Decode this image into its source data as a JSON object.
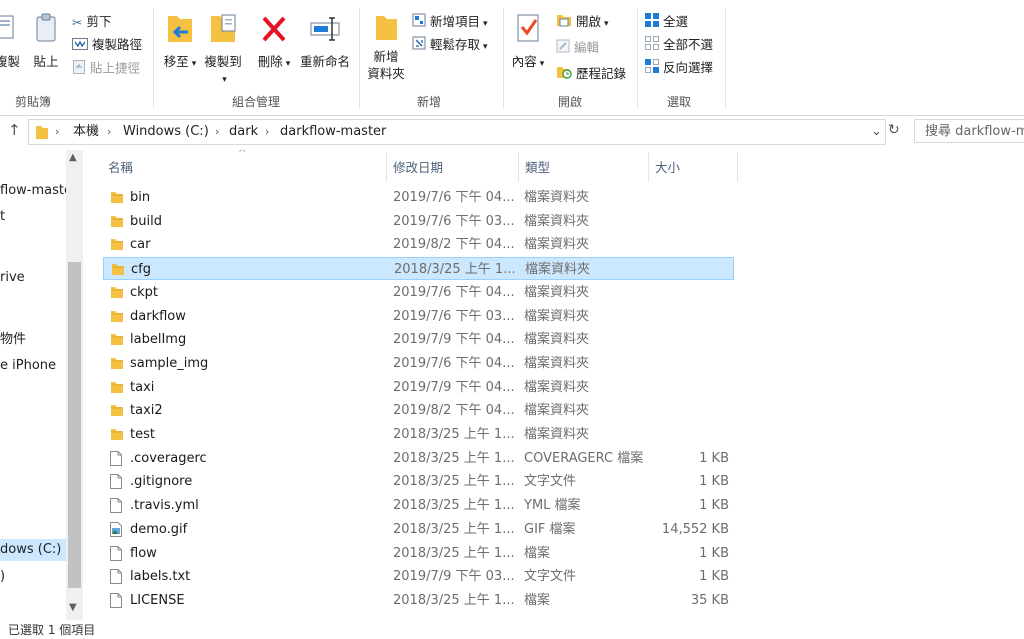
{
  "ribbon": {
    "clipboard": {
      "group_label": "剪貼簿",
      "copy_label": "複製",
      "paste_label": "貼上",
      "cut_label": "剪下",
      "copy_path_label": "複製路徑",
      "paste_shortcut_label": "貼上捷徑"
    },
    "organize": {
      "group_label": "組合管理",
      "move_to_label": "移至",
      "copy_to_label": "複製到",
      "delete_label": "刪除",
      "rename_label": "重新命名"
    },
    "new": {
      "group_label": "新增",
      "new_folder_label_line1": "新增",
      "new_folder_label_line2": "資料夾",
      "new_item_label": "新增項目",
      "easy_access_label": "輕鬆存取"
    },
    "open": {
      "group_label": "開啟",
      "properties_label": "內容",
      "open_label": "開啟",
      "edit_label": "編輯",
      "history_label": "歷程記錄"
    },
    "select": {
      "group_label": "選取",
      "select_all_label": "全選",
      "select_none_label": "全部不選",
      "invert_label": "反向選擇"
    }
  },
  "address": {
    "crumbs": [
      "本機",
      "Windows (C:)",
      "dark",
      "darkflow-master"
    ],
    "search_placeholder": "搜尋 darkflow-m"
  },
  "nav": {
    "items": [
      "flow-maste",
      "t",
      "rive",
      "物件",
      "e iPhone",
      "dows (C:)",
      ")"
    ]
  },
  "columns": {
    "name": "名稱",
    "date": "修改日期",
    "type": "類型",
    "size": "大小"
  },
  "files": [
    {
      "name": "bin",
      "date": "2019/7/6 下午 04...",
      "type": "檔案資料夾",
      "size": "",
      "icon": "folder"
    },
    {
      "name": "build",
      "date": "2019/7/6 下午 03...",
      "type": "檔案資料夾",
      "size": "",
      "icon": "folder"
    },
    {
      "name": "car",
      "date": "2019/8/2 下午 04...",
      "type": "檔案資料夾",
      "size": "",
      "icon": "folder"
    },
    {
      "name": "cfg",
      "date": "2018/3/25 上午 1...",
      "type": "檔案資料夾",
      "size": "",
      "icon": "folder"
    },
    {
      "name": "ckpt",
      "date": "2019/7/6 下午 04...",
      "type": "檔案資料夾",
      "size": "",
      "icon": "folder"
    },
    {
      "name": "darkflow",
      "date": "2019/7/6 下午 03...",
      "type": "檔案資料夾",
      "size": "",
      "icon": "folder"
    },
    {
      "name": "labelImg",
      "date": "2019/7/9 下午 04...",
      "type": "檔案資料夾",
      "size": "",
      "icon": "folder"
    },
    {
      "name": "sample_img",
      "date": "2019/7/6 下午 04...",
      "type": "檔案資料夾",
      "size": "",
      "icon": "folder"
    },
    {
      "name": "taxi",
      "date": "2019/7/9 下午 04...",
      "type": "檔案資料夾",
      "size": "",
      "icon": "folder"
    },
    {
      "name": "taxi2",
      "date": "2019/8/2 下午 04...",
      "type": "檔案資料夾",
      "size": "",
      "icon": "folder"
    },
    {
      "name": "test",
      "date": "2018/3/25 上午 1...",
      "type": "檔案資料夾",
      "size": "",
      "icon": "folder"
    },
    {
      "name": ".coveragerc",
      "date": "2018/3/25 上午 1...",
      "type": "COVERAGERC 檔案",
      "size": "1 KB",
      "icon": "file"
    },
    {
      "name": ".gitignore",
      "date": "2018/3/25 上午 1...",
      "type": "文字文件",
      "size": "1 KB",
      "icon": "file"
    },
    {
      "name": ".travis.yml",
      "date": "2018/3/25 上午 1...",
      "type": "YML 檔案",
      "size": "1 KB",
      "icon": "file"
    },
    {
      "name": "demo.gif",
      "date": "2018/3/25 上午 1...",
      "type": "GIF 檔案",
      "size": "14,552 KB",
      "icon": "image"
    },
    {
      "name": "flow",
      "date": "2018/3/25 上午 1...",
      "type": "檔案",
      "size": "1 KB",
      "icon": "file"
    },
    {
      "name": "labels.txt",
      "date": "2019/7/9 下午 03...",
      "type": "文字文件",
      "size": "1 KB",
      "icon": "file"
    },
    {
      "name": "LICENSE",
      "date": "2018/3/25 上午 1...",
      "type": "檔案",
      "size": "35 KB",
      "icon": "file"
    }
  ],
  "selected_index": 3,
  "status": {
    "text": "已選取 1 個項目"
  },
  "colors": {
    "selection_bg": "#cce8ff",
    "selection_border": "#99d1ff",
    "folder": "#f5c143",
    "delete_red": "#e81123",
    "accent_blue": "#1e7bd6"
  }
}
